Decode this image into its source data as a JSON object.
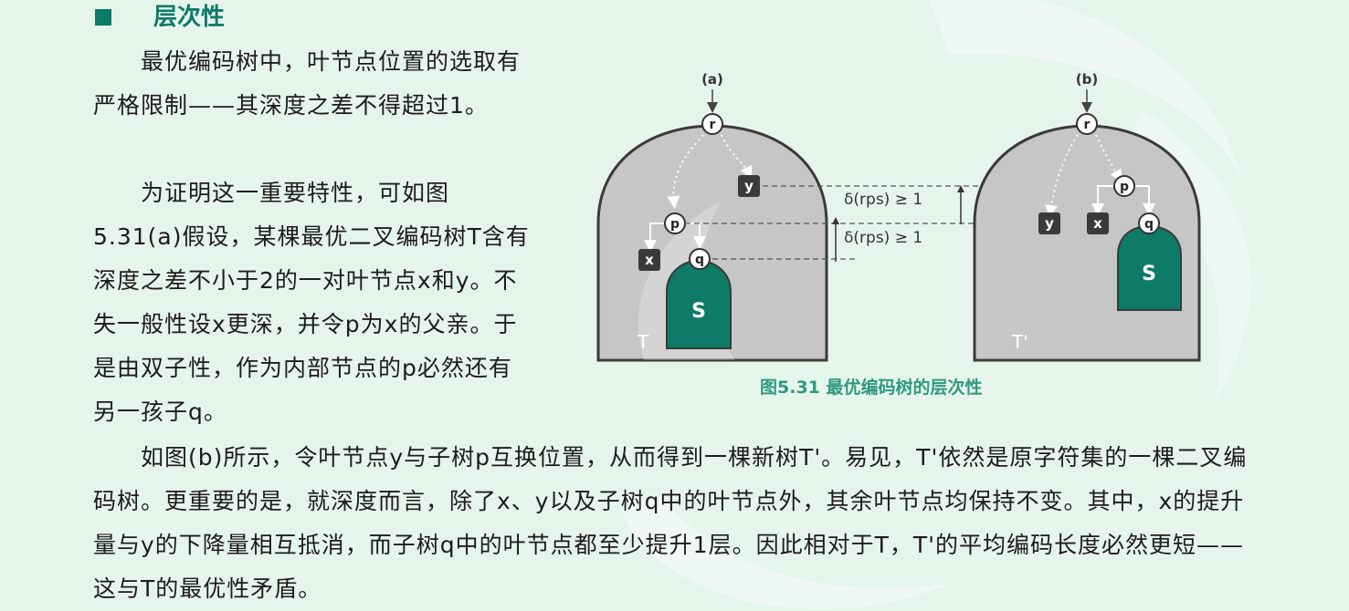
{
  "heading": {
    "title": "层次性"
  },
  "paragraphs": [
    "　　最优编码树中，叶节点位置的选取有严格限制——其深度之差不得超过1。",
    "　　为证明这一重要特性，可如图5.31(a)假设，某棵最优二叉编码树T含有深度之差不小于2的一对叶节点x和y。不失一般性设x更深，并令p为x的父亲。于是由双子性，作为内部节点的p必然还有另一孩子q。",
    "　　如图(b)所示，令叶节点y与子树p互换位置，从而得到一棵新树T'。易见，T'依然是原字符集的一棵二叉编码树。更重要的是，就深度而言，除了x、y以及子树q中的叶节点外，其余叶节点均保持不变。其中，x的提升量与y的下降量相互抵消，而子树q中的叶节点都至少提升1层。因此相对于T，T'的平均编码长度必然更短——这与T的最优性矛盾。"
  ],
  "figure": {
    "caption": "图5.31  最优编码树的层次性",
    "label_a": "(a)",
    "label_b": "(b)",
    "tree_left": "T",
    "tree_right": "T'",
    "node_r": "r",
    "node_p": "p",
    "node_q": "q",
    "node_x": "x",
    "node_y": "y",
    "subtree": "S",
    "delta_label": "δ(rps) ≥ 1"
  },
  "colors": {
    "accent": "#0e7a68",
    "caption": "#2f9a80",
    "tree_fill": "#c6c6c6",
    "subtree_fill": "#0e7a68",
    "background": "#e6f5ec"
  }
}
